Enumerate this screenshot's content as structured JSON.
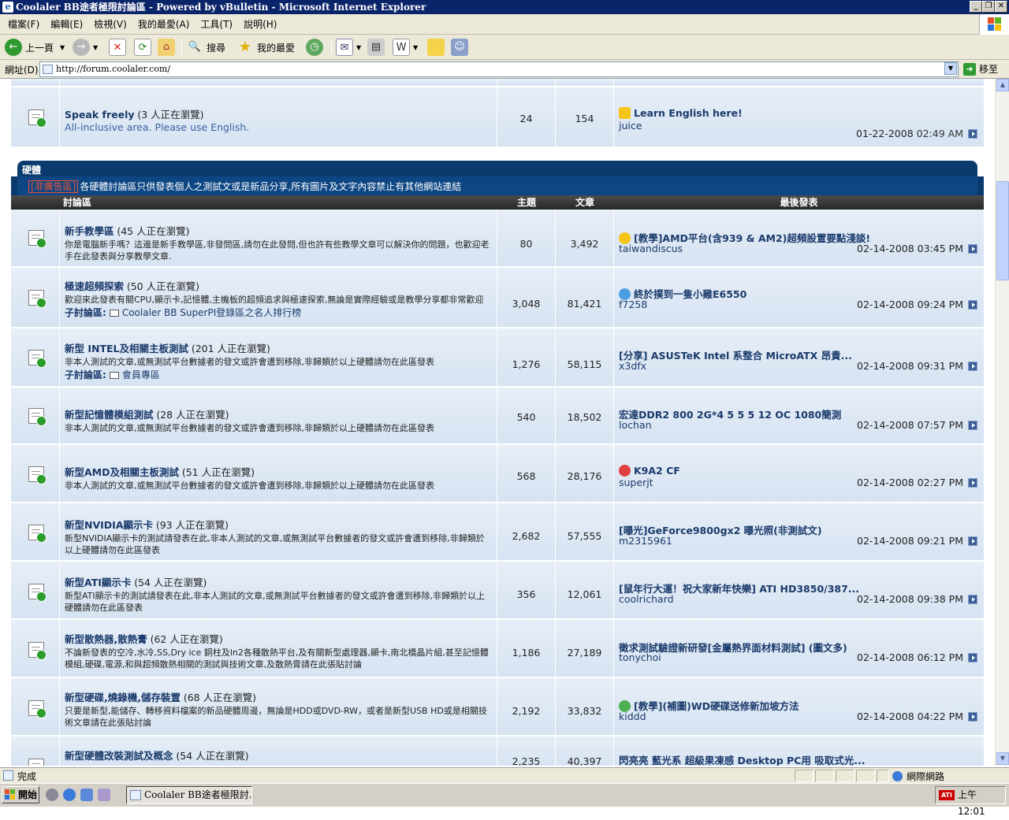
{
  "window": {
    "title": "Coolaler BB途者極限討論區 - Powered by vBulletin - Microsoft Internet Explorer"
  },
  "menu": [
    "檔案(F)",
    "編輯(E)",
    "檢視(V)",
    "我的最愛(A)",
    "工具(T)",
    "說明(H)"
  ],
  "toolbar": {
    "back": "上一頁",
    "search": "搜尋",
    "favorites": "我的最愛"
  },
  "address": {
    "label": "網址(D)",
    "url": "http://forum.coolaler.com/",
    "go": "移至"
  },
  "top_forum": {
    "name": "Speak freely",
    "viewers": "(3 人正在瀏覽)",
    "desc": "All-inclusive area. Please use English.",
    "threads": "24",
    "posts": "154",
    "last_title": "Learn English here!",
    "last_user": "juice",
    "last_date": "01-22-2008",
    "last_time": "02:49 AM"
  },
  "category": {
    "title": "硬體",
    "notice_tag": "[非廣告區]",
    "notice": "各硬體討論區只供發表個人之測試文或是新品分享,所有圖片及文字內容禁止有其他網站連結"
  },
  "columns": {
    "forum": "討論區",
    "threads": "主題",
    "posts": "文章",
    "last": "最後發表"
  },
  "forums": [
    {
      "name": "新手教學區",
      "viewers": "(45 人正在瀏覽)",
      "desc": "你是電腦新手嗎？這邊是新手教學區,非發問區,請勿在此發問,但也許有些教學文章可以解決你的問題，也歡迎老手在此發表與分享教學文章.",
      "threads": "80",
      "posts": "3,492",
      "last_title": "[教學]AMD平台(含939 & AM2)超頻設置要點淺談!",
      "last_user": "taiwandiscus",
      "last_date": "02-14-2008",
      "last_time": "03:45 PM"
    },
    {
      "name": "極速超頻探索",
      "viewers": "(50 人正在瀏覽)",
      "desc": "歡迎來此發表有關CPU,顯示卡,記憶體,主機板的超頻追求與極速探索,無論是實際經驗或是教學分享都非常歡迎",
      "subforum_label": "子討論區:",
      "subforum": "Coolaler BB SuperPI登錄區之名人排行榜",
      "threads": "3,048",
      "posts": "81,421",
      "last_title": "終於撲到一隻小雞E6550",
      "last_user": "f7258",
      "last_date": "02-14-2008",
      "last_time": "09:24 PM"
    },
    {
      "name": "新型 INTEL及相關主板測試",
      "viewers": "(201 人正在瀏覽)",
      "desc": "非本人測試的文章,或無測試平台數據者的發文或許會遭到移除,非歸類於以上硬體請勿在此區發表",
      "subforum_label": "子討論區:",
      "subforum": "會員專區",
      "threads": "1,276",
      "posts": "58,115",
      "last_title": "[分享] ASUSTeK Intel 系整合 MicroATX 昂貴...",
      "last_user": "x3dfx",
      "last_date": "02-14-2008",
      "last_time": "09:31 PM"
    },
    {
      "name": "新型記憶體模組測試",
      "viewers": "(28 人正在瀏覽)",
      "desc": "非本人測試的文章,或無測試平台數據者的發文或許會遭到移除,非歸類於以上硬體請勿在此區發表",
      "threads": "540",
      "posts": "18,502",
      "last_title": "宏達DDR2 800 2G*4 5 5 5 12 OC 1080簡測",
      "last_user": "lochan",
      "last_date": "02-14-2008",
      "last_time": "07:57 PM"
    },
    {
      "name": "新型AMD及相關主板測試",
      "viewers": "(51 人正在瀏覽)",
      "desc": "非本人測試的文章,或無測試平台數據者的發文或許會遭到移除,非歸類於以上硬體請勿在此區發表",
      "threads": "568",
      "posts": "28,176",
      "last_title": "K9A2 CF",
      "last_user": "superjt",
      "last_date": "02-14-2008",
      "last_time": "02:27 PM"
    },
    {
      "name": "新型NVIDIA顯示卡",
      "viewers": "(93 人正在瀏覽)",
      "desc": "新型NVIDIA顯示卡的測試請發表在此,非本人測試的文章,或無測試平台數據者的發文或許會遭到移除,非歸類於以上硬體請勿在此區發表",
      "threads": "2,682",
      "posts": "57,555",
      "last_title": "[曝光]GeForce9800gx2 曝光照(非測試文)",
      "last_user": "m2315961",
      "last_date": "02-14-2008",
      "last_time": "09:21 PM"
    },
    {
      "name": "新型ATI顯示卡",
      "viewers": "(54 人正在瀏覽)",
      "desc": "新型ATI顯示卡的測試請發表在此,非本人測試的文章,或無測試平台數據者的發文或許會遭到移除,非歸類於以上硬體請勿在此區發表",
      "threads": "356",
      "posts": "12,061",
      "last_title": "[鼠年行大運！祝大家新年快樂] ATI HD3850/387...",
      "last_user": "coolrichard",
      "last_date": "02-14-2008",
      "last_time": "09:38 PM"
    },
    {
      "name": "新型散熱器,散熱膏",
      "viewers": "(62 人正在瀏覽)",
      "desc": "不論新發表的空冷,水冷,SS,Dry ice 銅柱及ln2各種散熱平台,及有關新型處理器,顯卡,南北橋晶片組,甚至記憶體模組,硬碟,電源,和與超頻散熱相關的測試與技術文章,及散熱膏請在此張貼討論",
      "threads": "1,186",
      "posts": "27,189",
      "last_title": "徵求測試驗證新研發[金屬熱界面材料測試] (圖文多)",
      "last_user": "tonychoi",
      "last_date": "02-14-2008",
      "last_time": "06:12 PM"
    },
    {
      "name": "新型硬碟,燒錄機,儲存裝置",
      "viewers": "(68 人正在瀏覽)",
      "desc": "只要是新型,能儲存、轉移資料檔案的新品硬體周邊，無論是HDD或DVD-RW，或者是新型USB HD或是相關技術文章請在此張貼討論",
      "threads": "2,192",
      "posts": "33,832",
      "last_title": "[教學](補圖)WD硬碟送修新加坡方法",
      "last_user": "kiddd",
      "last_date": "02-14-2008",
      "last_time": "04:22 PM"
    },
    {
      "name": "新型硬體改裝測試及概念",
      "viewers": "(54 人正在瀏覽)",
      "desc": "",
      "threads": "2,235",
      "posts": "40,397",
      "last_title": "閃亮亮 藍光系 超級果凍感 Desktop PC用 吸取式光...",
      "last_user": "",
      "last_date": "",
      "last_time": ""
    }
  ],
  "status": {
    "text": "完成",
    "zone": "網際網路"
  },
  "taskbar": {
    "start": "開始",
    "task": "Coolaler BB途者極限討...",
    "clock": "上午 12:01"
  },
  "colors": {
    "row": "#dde8f5",
    "category": "#0a3a6e",
    "colhead": "#333333",
    "link": "#1a3a6b"
  }
}
